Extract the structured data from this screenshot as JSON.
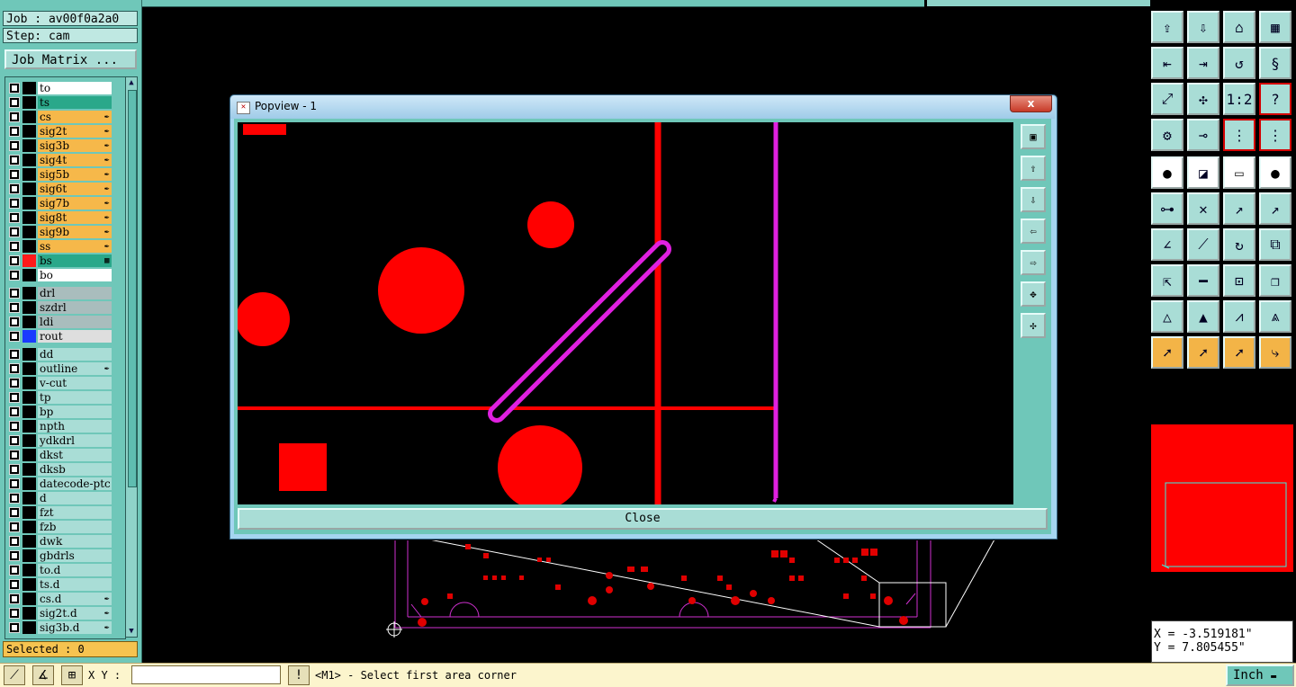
{
  "job": {
    "job_label": "Job : av00f0a2a0",
    "step_label": "Step: cam",
    "matrix_button": "Job Matrix ..."
  },
  "layers": [
    {
      "name": "to",
      "bg": "#ffffff",
      "color": "#000000",
      "flag": ""
    },
    {
      "name": "ts",
      "bg": "#2aa88a",
      "color": "#000000",
      "flag": ""
    },
    {
      "name": "cs",
      "bg": "#f6b84a",
      "color": "#000000",
      "flag": "✒"
    },
    {
      "name": "sig2t",
      "bg": "#f6b84a",
      "color": "#000000",
      "flag": "✒"
    },
    {
      "name": "sig3b",
      "bg": "#f6b84a",
      "color": "#000000",
      "flag": "✒"
    },
    {
      "name": "sig4t",
      "bg": "#f6b84a",
      "color": "#000000",
      "flag": "✒"
    },
    {
      "name": "sig5b",
      "bg": "#f6b84a",
      "color": "#000000",
      "flag": "✒"
    },
    {
      "name": "sig6t",
      "bg": "#f6b84a",
      "color": "#000000",
      "flag": "✒"
    },
    {
      "name": "sig7b",
      "bg": "#f6b84a",
      "color": "#000000",
      "flag": "✒"
    },
    {
      "name": "sig8t",
      "bg": "#f6b84a",
      "color": "#000000",
      "flag": "✒"
    },
    {
      "name": "sig9b",
      "bg": "#f6b84a",
      "color": "#000000",
      "flag": "✒"
    },
    {
      "name": "ss",
      "bg": "#f6b84a",
      "color": "#000000",
      "flag": "✒"
    },
    {
      "name": "bs",
      "bg": "#2aa88a",
      "color": "#ff1a1a",
      "flag": "▦"
    },
    {
      "name": "bo",
      "bg": "#ffffff",
      "color": "#000000",
      "flag": ""
    },
    {
      "name": "drl",
      "bg": "#a9bdbd",
      "color": "#000000",
      "flag": ""
    },
    {
      "name": "szdrl",
      "bg": "#a9bdbd",
      "color": "#000000",
      "flag": ""
    },
    {
      "name": "ldi",
      "bg": "#a9bdbd",
      "color": "#000000",
      "flag": ""
    },
    {
      "name": "rout",
      "bg": "#dedede",
      "color": "#1a3aff",
      "flag": ""
    },
    {
      "name": "dd",
      "bg": "#a9ddd6",
      "color": "#000000",
      "flag": ""
    },
    {
      "name": "outline",
      "bg": "#a9ddd6",
      "color": "#000000",
      "flag": "✒"
    },
    {
      "name": "v-cut",
      "bg": "#a9ddd6",
      "color": "#000000",
      "flag": ""
    },
    {
      "name": "tp",
      "bg": "#a9ddd6",
      "color": "#000000",
      "flag": ""
    },
    {
      "name": "bp",
      "bg": "#a9ddd6",
      "color": "#000000",
      "flag": ""
    },
    {
      "name": "npth",
      "bg": "#a9ddd6",
      "color": "#000000",
      "flag": ""
    },
    {
      "name": "ydkdrl",
      "bg": "#a9ddd6",
      "color": "#000000",
      "flag": ""
    },
    {
      "name": "dkst",
      "bg": "#a9ddd6",
      "color": "#000000",
      "flag": ""
    },
    {
      "name": "dksb",
      "bg": "#a9ddd6",
      "color": "#000000",
      "flag": ""
    },
    {
      "name": "datecode-ptc",
      "bg": "#a9ddd6",
      "color": "#000000",
      "flag": ""
    },
    {
      "name": "d",
      "bg": "#a9ddd6",
      "color": "#000000",
      "flag": ""
    },
    {
      "name": "fzt",
      "bg": "#a9ddd6",
      "color": "#000000",
      "flag": ""
    },
    {
      "name": "fzb",
      "bg": "#a9ddd6",
      "color": "#000000",
      "flag": ""
    },
    {
      "name": "dwk",
      "bg": "#a9ddd6",
      "color": "#000000",
      "flag": ""
    },
    {
      "name": "gbdrls",
      "bg": "#a9ddd6",
      "color": "#000000",
      "flag": ""
    },
    {
      "name": "to.d",
      "bg": "#a9ddd6",
      "color": "#000000",
      "flag": ""
    },
    {
      "name": "ts.d",
      "bg": "#a9ddd6",
      "color": "#000000",
      "flag": ""
    },
    {
      "name": "cs.d",
      "bg": "#a9ddd6",
      "color": "#000000",
      "flag": "✒"
    },
    {
      "name": "sig2t.d",
      "bg": "#a9ddd6",
      "color": "#000000",
      "flag": "✒"
    },
    {
      "name": "sig3b.d",
      "bg": "#a9ddd6",
      "color": "#000000",
      "flag": "✒"
    }
  ],
  "selected_label": "Selected : 0",
  "popview": {
    "title": "Popview - 1",
    "close_x": "x",
    "close_button": "Close"
  },
  "coords": {
    "x": "X = -3.519181\"",
    "y": "Y = 7.805455\""
  },
  "bottom": {
    "xy_label": "X Y :",
    "xy_value": "",
    "prompt": "<M1> - Select first area corner",
    "units": "Inch"
  },
  "tools": [
    "top-icon",
    "bottom-icon",
    "home-icon",
    "grid-icon",
    "left-icon",
    "right-icon",
    "undo-icon",
    "snake-icon",
    "fit-icon",
    "center-icon",
    "1:2",
    "help-icon",
    "wrench-icon",
    "key-icon",
    "stack-icon",
    "stack2-icon",
    "select-icon",
    "measure-icon",
    "ruler-icon",
    "dot-icon",
    "net-icon",
    "cross-icon",
    "arrow-icon",
    "arrow2-icon",
    "line-icon",
    "line2-icon",
    "rotate-icon",
    "mirror-icon",
    "move-icon",
    "minus-icon",
    "align-icon",
    "copy-icon",
    "tri-icon",
    "tri2-icon",
    "tri3-icon",
    "tri4-icon",
    "pointer-icon",
    "pointer2-icon",
    "pointer3-icon",
    "path-icon"
  ]
}
